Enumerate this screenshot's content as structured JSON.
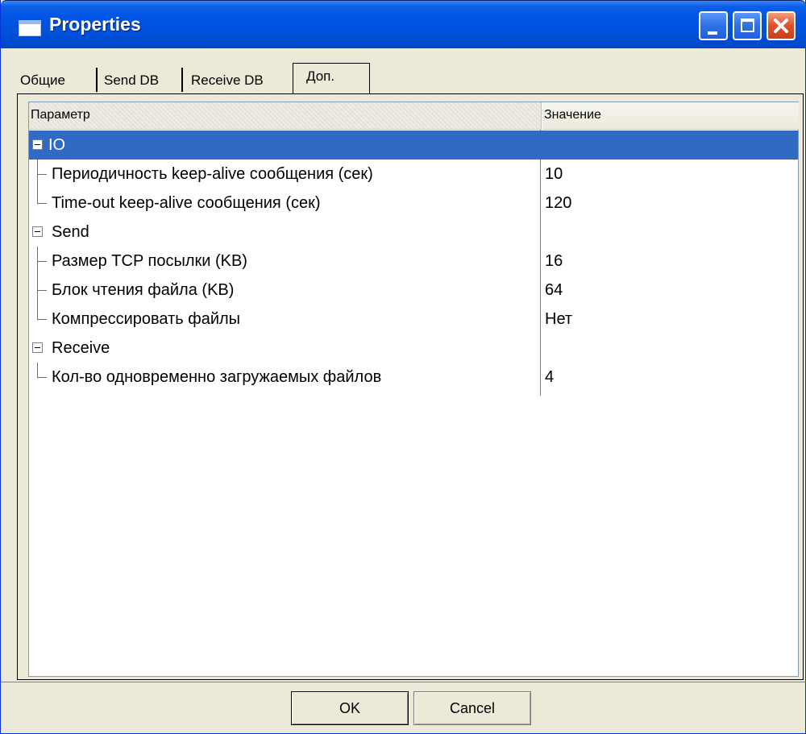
{
  "window": {
    "title": "Properties",
    "icon": "window-icon",
    "controls": {
      "minimize": "minimize-icon",
      "maximize": "maximize-icon",
      "close": "close-icon"
    }
  },
  "tabs": [
    {
      "label": "Общие",
      "active": false
    },
    {
      "label": "Send DB",
      "active": false
    },
    {
      "label": "Receive DB",
      "active": false
    },
    {
      "label": "Доп.",
      "active": true
    }
  ],
  "grid": {
    "columns": [
      "Параметр",
      "Значение"
    ],
    "groups": [
      {
        "name": "IO",
        "selected": true,
        "items": [
          {
            "name": "Периодичность keep-alive сообщения (сек)",
            "value": "10"
          },
          {
            "name": "Time-out keep-alive сообщения (сек)",
            "value": "120"
          }
        ]
      },
      {
        "name": "Send",
        "selected": false,
        "items": [
          {
            "name": "Размер TCP посылки (KB)",
            "value": "16"
          },
          {
            "name": "Блок чтения файла (KB)",
            "value": "64"
          },
          {
            "name": "Компрессировать файлы",
            "value": "Нет"
          }
        ]
      },
      {
        "name": "Receive",
        "selected": false,
        "items": [
          {
            "name": "Кол-во одновременно загружаемых файлов",
            "value": "4"
          }
        ]
      }
    ]
  },
  "buttons": {
    "ok": "OK",
    "cancel": "Cancel"
  },
  "colors": {
    "title_bar": "#0054e3",
    "selection": "#316ac5",
    "face": "#ece9d8",
    "close_button": "#e0502a"
  }
}
